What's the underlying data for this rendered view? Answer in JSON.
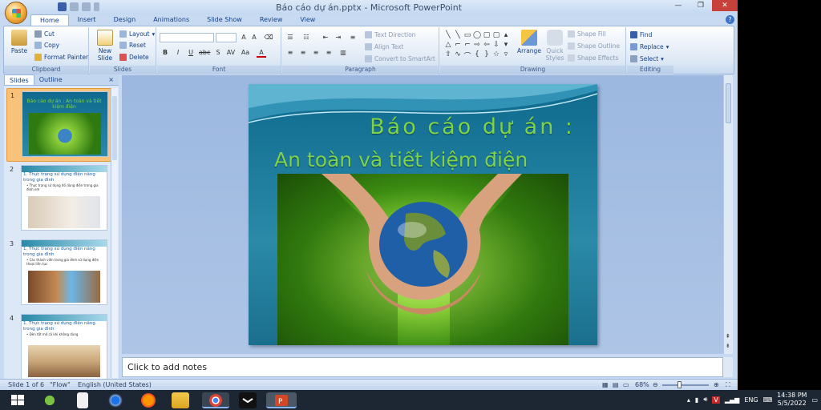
{
  "window": {
    "title": "Báo cáo dự án.pptx - Microsoft PowerPoint"
  },
  "tabs": [
    "Home",
    "Insert",
    "Design",
    "Animations",
    "Slide Show",
    "Review",
    "View"
  ],
  "ribbon": {
    "clipboard": {
      "label": "Clipboard",
      "paste": "Paste",
      "cut": "Cut",
      "copy": "Copy",
      "format_painter": "Format Painter"
    },
    "slides": {
      "label": "Slides",
      "new_slide_1": "New",
      "new_slide_2": "Slide",
      "layout": "Layout",
      "reset": "Reset",
      "delete": "Delete"
    },
    "font": {
      "label": "Font"
    },
    "paragraph": {
      "label": "Paragraph",
      "text_direction": "Text Direction",
      "align_text": "Align Text",
      "convert_smartart": "Convert to SmartArt"
    },
    "drawing": {
      "label": "Drawing",
      "arrange": "Arrange",
      "quick_styles_1": "Quick",
      "quick_styles_2": "Styles",
      "shape_fill": "Shape Fill",
      "shape_outline": "Shape Outline",
      "shape_effects": "Shape Effects"
    },
    "editing": {
      "label": "Editing",
      "find": "Find",
      "replace": "Replace",
      "select": "Select"
    }
  },
  "left_pane": {
    "tab_slides": "Slides",
    "tab_outline": "Outline",
    "close": "×",
    "thumbs": [
      {
        "num": "1",
        "title": "Báo cáo dự án : An toàn và tiết kiệm điện"
      },
      {
        "num": "2",
        "title": "1. Thực trạng sử dụng điện năng trong gia đình",
        "bullet": "• Thực trạng sử dụng đồ dùng điện trong gia đình em"
      },
      {
        "num": "3",
        "title": "1. Thực trạng sử dụng điện năng trong gia đình",
        "bullet": "• Các thành viên trong gia đình sử dụng điện thoại liên tục"
      },
      {
        "num": "4",
        "title": "1. Thực trạng sử dụng điện năng trong gia đình",
        "bullet": "• Đèn tắt mở cả khi không dùng"
      }
    ]
  },
  "slide": {
    "title_line1": "Báo cáo dự án :",
    "title_line2": "An toàn và tiết kiệm điện"
  },
  "notes": {
    "placeholder": "Click to add notes"
  },
  "status": {
    "slide_info": "Slide 1 of 6",
    "theme": "\"Flow\"",
    "language": "English (United States)",
    "zoom": "68%"
  },
  "taskbar": {
    "lang": "ENG",
    "time": "14:38 PM",
    "date": "5/5/2022"
  },
  "colors": {
    "title_green": "#7fd24a",
    "ribbon_blue": "#c8daf1",
    "accent_orange": "#f8c27b"
  }
}
